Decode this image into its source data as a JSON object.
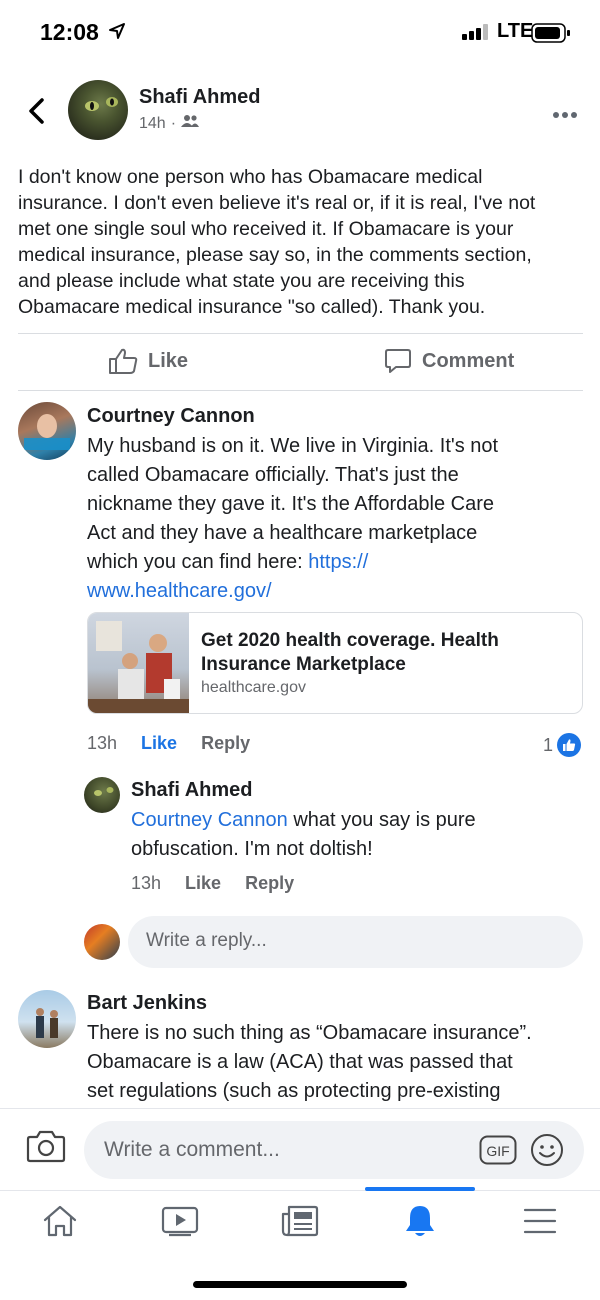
{
  "status_bar": {
    "time": "12:08",
    "network": "LTE"
  },
  "post": {
    "author": "Shafi Ahmed",
    "time": "14h",
    "privacy_icon": "friends-icon",
    "text_lines": [
      "I don't know one person who has Obamacare medical",
      "insurance.  I don't even believe it's real or, if it is real, I've not",
      "met one single soul who received it.  If Obamacare is your",
      "medical insurance, please say so, in the comments section,",
      "and please include what state you are receiving this",
      "Obamacare medical insurance \"so called).  Thank you."
    ]
  },
  "actions": {
    "like_label": "Like",
    "comment_label": "Comment"
  },
  "comments": [
    {
      "author": "Courtney Cannon",
      "text_lines": [
        "My husband is on it. We live in Virginia. It's not",
        "called Obamacare officially. That's just the",
        "nickname they gave it. It's the Affordable Care",
        "Act and they have a healthcare marketplace",
        "which you can find here: "
      ],
      "link_part1": "https://",
      "link_part2": "www.healthcare.gov/",
      "link_card": {
        "title": "Get 2020 health coverage. Health Insurance Marketplace",
        "domain": "healthcare.gov"
      },
      "time": "13h",
      "like_label": "Like",
      "reply_label": "Reply",
      "reaction_count": "1"
    }
  ],
  "reply": {
    "author": "Shafi Ahmed",
    "mention": "Courtney Cannon",
    "text_line1": " what you say is pure",
    "text_line2": "obfuscation.  I'm not doltish!",
    "time": "13h",
    "like_label": "Like",
    "reply_label": "Reply"
  },
  "reply_box": {
    "placeholder": "Write a reply..."
  },
  "comment2": {
    "author": "Bart Jenkins",
    "text_lines": [
      "There is no such thing as “Obamacare insurance”.",
      "Obamacare is a law (ACA) that was passed that",
      "set regulations (such as protecting pre-existing"
    ]
  },
  "composer": {
    "placeholder": "Write a comment...",
    "gif_label": "GIF"
  },
  "tabs": [
    {
      "name": "home-icon"
    },
    {
      "name": "watch-icon"
    },
    {
      "name": "news-icon"
    },
    {
      "name": "notifications-icon",
      "active": true
    },
    {
      "name": "menu-icon"
    }
  ],
  "colors": {
    "accent": "#1877f2",
    "link": "#216fdb",
    "muted": "#65676b"
  }
}
